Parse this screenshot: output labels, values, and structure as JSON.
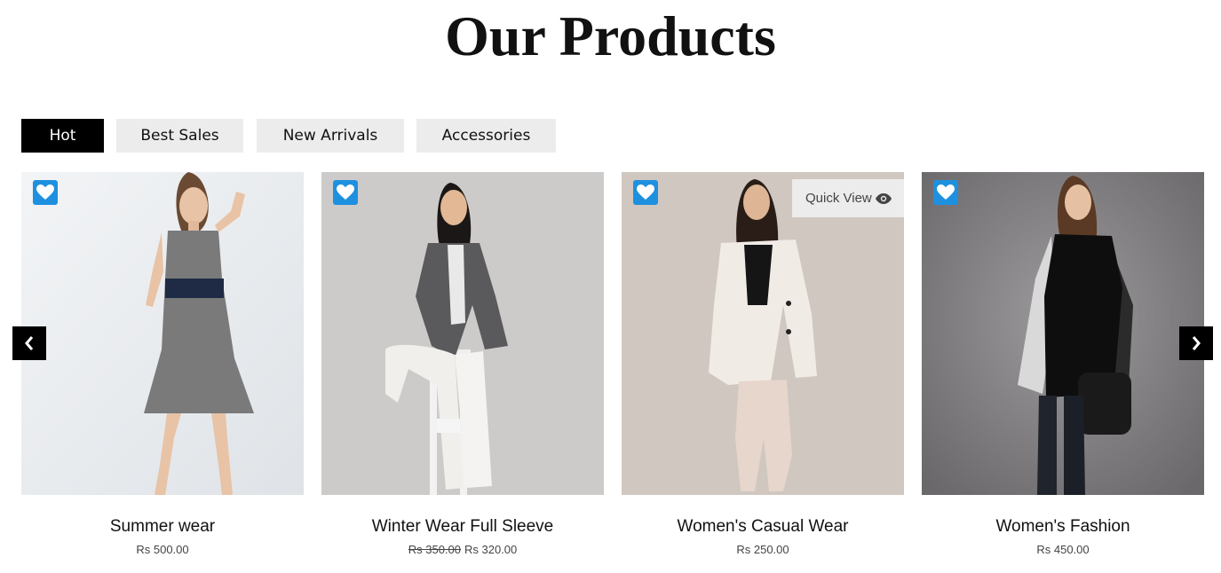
{
  "page": {
    "title": "Our Products"
  },
  "tabs": [
    {
      "label": "Hot",
      "active": true
    },
    {
      "label": "Best Sales",
      "active": false
    },
    {
      "label": "New Arrivals",
      "active": false
    },
    {
      "label": "Accessories",
      "active": false
    }
  ],
  "products": [
    {
      "name": "Summer wear",
      "price": "Rs 500.00",
      "old_price": ""
    },
    {
      "name": "Winter Wear Full Sleeve",
      "price": "Rs 320.00",
      "old_price": "Rs 350.00"
    },
    {
      "name": "Women's Casual Wear",
      "price": "Rs 250.00",
      "old_price": "",
      "quick_view": "Quick View"
    },
    {
      "name": "Women's Fashion",
      "price": "Rs 450.00",
      "old_price": ""
    }
  ],
  "icons": {
    "wishlist": "heart-icon",
    "quick_view": "eye-icon",
    "prev": "chevron-left-icon",
    "next": "chevron-right-icon"
  },
  "colors": {
    "accent": "#1e90e0",
    "active_tab": "#000000",
    "tab_bg": "#ececec"
  }
}
